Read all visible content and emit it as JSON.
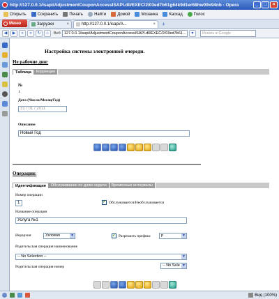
{
  "window": {
    "title": "http://127.0.0.1/isapi/AdjustmentCouponAccessISAPI.dll/EXEC/2/03ed7b61g64k9d1er68hw09x94nb - Opera"
  },
  "toolbar": {
    "open": "Открыть",
    "save": "Сохранить",
    "print": "Печать",
    "find": "Найти",
    "home": "Домой",
    "mosaic": "Мозаика",
    "cascade": "Каскад",
    "voice": "Голос"
  },
  "tabs": {
    "menu": "Меню",
    "items": [
      {
        "label": "Загрузки"
      },
      {
        "label": "http://127.0.0.1/isapi/A..."
      }
    ]
  },
  "address": {
    "veb": "Веб",
    "url": "127.0.0.1/isapi/AdjustmentCouponAccessISAPI.dll/EXEC/2/03ed7b61...",
    "search_placeholder": "Искать в Google"
  },
  "page": {
    "title": "Настройка системы электронной очереди.",
    "holidays": {
      "heading": "Не рабочие дни:",
      "tabs": [
        "Таблица",
        "Коррекция"
      ],
      "num_label": "№",
      "num_value": "1",
      "date_label": "Дата (Число/Месяц/Год)",
      "date_value": "31 / 01 / 2011",
      "desc_label": "Описание",
      "desc_value": "Новый Год"
    },
    "operations": {
      "heading": "Операции:",
      "tabs": [
        "Идентификация",
        "Обслуживание по дням недели",
        "Временные интервалы"
      ],
      "opnum_label": "Номер операции",
      "opnum_value": "1",
      "served_label": "Обслуживается/Необслуживается",
      "opname_label": "Название операции",
      "opname_value": "Услуга №1",
      "hierarchy_label": "Иерархия",
      "hierarchy_value": "Узловая",
      "prefix_label": "Разрешить префикс",
      "prefix_value": "р",
      "parent_name_label": "Родительская операция наименование",
      "parent_name_value": "-- No Selection --",
      "parent_num_label": "Родительская операция номер",
      "parent_num_value": "-- No Sele"
    }
  },
  "statusbar": {
    "zoom": "Вид (100%)"
  }
}
